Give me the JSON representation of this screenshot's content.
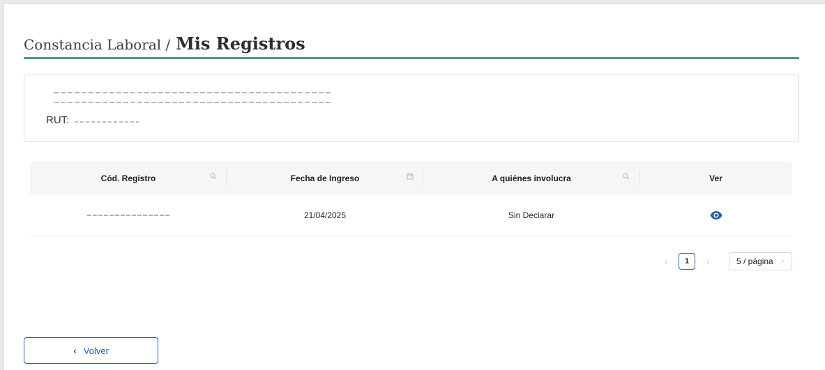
{
  "header": {
    "breadcrumb_prefix": "Constancia Laboral /",
    "title": "Mis Registros"
  },
  "info": {
    "rut_label": "RUT:"
  },
  "table": {
    "columns": [
      {
        "label": "Cód. Registro",
        "icon": "search-icon"
      },
      {
        "label": "Fecha de Ingreso",
        "icon": "calendar-icon"
      },
      {
        "label": "A quiénes involucra",
        "icon": "search-icon"
      },
      {
        "label": "Ver",
        "icon": ""
      }
    ],
    "rows": [
      {
        "fecha": "21/04/2025",
        "involucra": "Sin Declarar",
        "action_icon": "eye-icon"
      }
    ]
  },
  "pagination": {
    "current_page": "1",
    "page_size": "5 / página"
  },
  "footer": {
    "back_label": "Volver"
  },
  "colors": {
    "accent_green": "#479a74",
    "primary_blue": "#1f5fa8"
  }
}
